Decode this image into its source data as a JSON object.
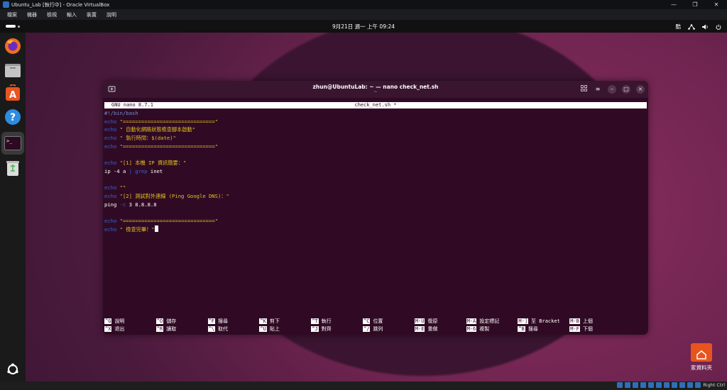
{
  "vbox": {
    "title": "Ubuntu_Lab [執行中] - Oracle VirtualBox",
    "menu": [
      "檔案",
      "機器",
      "檢視",
      "輸入",
      "裝置",
      "說明"
    ],
    "window_controls": [
      "—",
      "❐",
      "✕"
    ],
    "status_right": "Right Ctrl"
  },
  "panel": {
    "clock": "9月21日 週一 上午 09:24",
    "ime": "酷"
  },
  "terminal": {
    "title": "zhun@UbuntuLab: ~ — nano check_net.sh",
    "subtitle": "~"
  },
  "nano": {
    "version": "GNU nano 8.7.1",
    "filename": "check_net.sh *",
    "lines": [
      {
        "t": "comment",
        "text": "#!/bin/bash"
      },
      {
        "t": "echo",
        "cmd": "echo",
        "str": "\"==============================\""
      },
      {
        "t": "echo",
        "cmd": "echo",
        "str": "\" 自動化網路狀態檢查腳本啟動\""
      },
      {
        "t": "echo",
        "cmd": "echo",
        "str": "\" 執行時間：$(date)\""
      },
      {
        "t": "echo",
        "cmd": "echo",
        "str": "\"==============================\""
      },
      {
        "t": "blank"
      },
      {
        "t": "echo",
        "cmd": "echo",
        "str": "\"[1] 本機 IP 資訊簡要：\""
      },
      {
        "t": "pipe",
        "a": "ip -4 a ",
        "b": "| ",
        "c": "grep",
        "d": " inet"
      },
      {
        "t": "blank"
      },
      {
        "t": "echo",
        "cmd": "echo",
        "str": "\"\""
      },
      {
        "t": "echo",
        "cmd": "echo",
        "str": "\"[2] 測試對外連線 (Ping Google DNS)：\""
      },
      {
        "t": "ping",
        "a": "ping ",
        "b": "-c",
        "c": " 3 8.8.8.8"
      },
      {
        "t": "blank"
      },
      {
        "t": "echo",
        "cmd": "echo",
        "str": "\"==============================\""
      },
      {
        "t": "echo",
        "cmd": "echo",
        "str": "\" 檢查完畢！\"",
        "cursor": true
      }
    ],
    "shortcuts_row1": [
      {
        "k": "^G",
        "l": "說明"
      },
      {
        "k": "^O",
        "l": "儲存"
      },
      {
        "k": "^F",
        "l": "搜尋"
      },
      {
        "k": "^K",
        "l": "剪下"
      },
      {
        "k": "^T",
        "l": "執行"
      },
      {
        "k": "^C",
        "l": "位置"
      },
      {
        "k": "M-U",
        "l": "復原"
      },
      {
        "k": "M-A",
        "l": "設定標記"
      },
      {
        "k": "M-]",
        "l": "至 Bracket"
      },
      {
        "k": "M-B",
        "l": "上個"
      }
    ],
    "shortcuts_row2": [
      {
        "k": "^X",
        "l": "退出"
      },
      {
        "k": "^R",
        "l": "讀取"
      },
      {
        "k": "^\\",
        "l": "取代"
      },
      {
        "k": "^U",
        "l": "貼上"
      },
      {
        "k": "^J",
        "l": "對齊"
      },
      {
        "k": "^/",
        "l": "跳列"
      },
      {
        "k": "M-E",
        "l": "重做"
      },
      {
        "k": "M-6",
        "l": "複製"
      },
      {
        "k": "^B",
        "l": "搜尋"
      },
      {
        "k": "M-F",
        "l": "下個"
      }
    ]
  },
  "desktop": {
    "home_label": "家資料夾"
  },
  "dock": [
    "firefox-icon",
    "files-icon",
    "app-center-icon",
    "help-icon",
    "terminal-icon",
    "trash-icon",
    "show-apps-icon"
  ]
}
